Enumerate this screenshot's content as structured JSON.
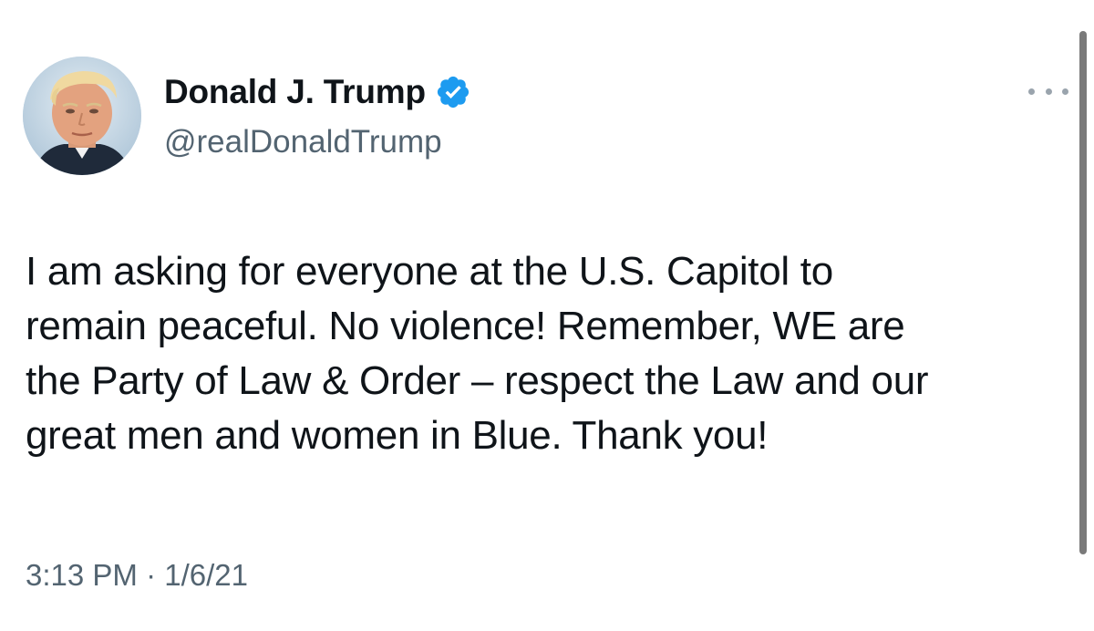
{
  "tweet": {
    "author": {
      "display_name": "Donald J. Trump",
      "handle": "@realDonaldTrump",
      "verified": true,
      "avatar_icon": "profile-photo"
    },
    "text": "I am asking for everyone at the U.S. Capitol to\nremain peaceful. No violence! Remember, WE are\nthe Party of Law & Order – respect the Law and our\ngreat men and women in Blue. Thank you!",
    "timestamp": "3:13 PM · 1/6/21",
    "more_icon": "more-horizontal-icon"
  },
  "colors": {
    "text_primary": "#0f1419",
    "text_secondary": "#536471",
    "verified_blue": "#1d9bf0",
    "more_dots": "#9aa4ad",
    "scrollbar": "#7a7a7a"
  }
}
